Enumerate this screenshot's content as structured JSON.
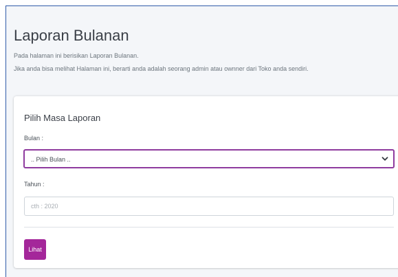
{
  "header": {
    "title": "Laporan Bulanan",
    "description_1": "Pada halaman ini berisikan Laporan Bulanan.",
    "description_2": "Jika anda bisa melihat Halaman ini, berarti anda adalah seorang admin atau ownner dari Toko anda sendiri."
  },
  "form": {
    "card_title": "Pilih Masa Laporan",
    "bulan_label": "Bulan :",
    "bulan_selected": ".. Pilih Bulan ..",
    "tahun_label": "Tahun :",
    "tahun_placeholder": "cth : 2020",
    "submit_label": "Lihat"
  },
  "icons": {
    "select_arrow": "chevron-down-icon"
  },
  "colors": {
    "accent": "#a4279a",
    "select_border": "#8e3a9e",
    "frame_border": "#2f5aa8"
  }
}
